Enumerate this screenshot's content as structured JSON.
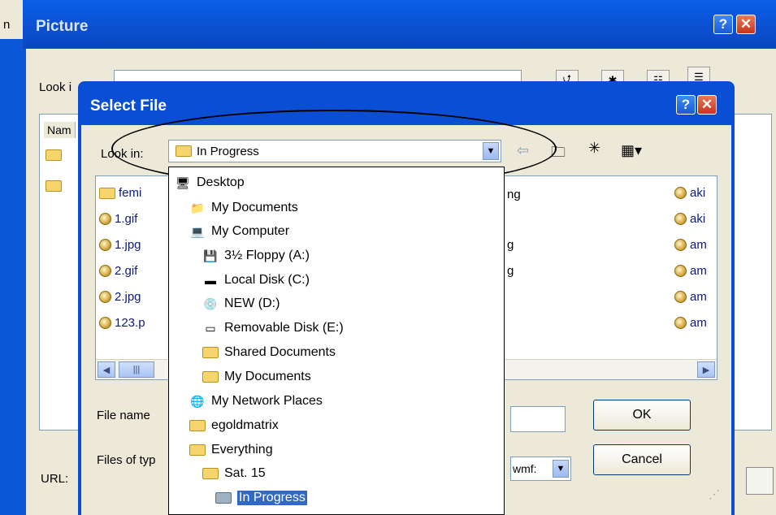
{
  "background_window": {
    "left_edge_char": "n",
    "title": "Picture",
    "look_in_label": "Look i",
    "name_header": "Nam",
    "url_label": "URL:"
  },
  "dialog": {
    "title": "Select File",
    "look_in_label": "Look in:",
    "look_in_value": "In Progress",
    "file_name_label": "File name",
    "files_of_type_label": "Files of typ",
    "files_of_type_value": "wmf:",
    "ok_label": "OK",
    "cancel_label": "Cancel"
  },
  "file_list": {
    "left_column": [
      "femi",
      "1.gif",
      "1.jpg",
      "2.gif",
      "2.jpg",
      "123.p"
    ],
    "middle_column": [
      "ng",
      "g",
      "g"
    ],
    "right_column": [
      "aki",
      "aki",
      "am",
      "am",
      "am",
      "am"
    ]
  },
  "dropdown": {
    "items": [
      {
        "label": "Desktop",
        "icon": "desktop-icon",
        "indent": 0,
        "selected": false
      },
      {
        "label": "My Documents",
        "icon": "my-documents-icon",
        "indent": 1,
        "selected": false
      },
      {
        "label": "My Computer",
        "icon": "my-computer-icon",
        "indent": 1,
        "selected": false
      },
      {
        "label": "3½ Floppy (A:)",
        "icon": "floppy-icon",
        "indent": 2,
        "selected": false
      },
      {
        "label": "Local Disk (C:)",
        "icon": "local-disk-icon",
        "indent": 2,
        "selected": false
      },
      {
        "label": "NEW (D:)",
        "icon": "cd-drive-icon",
        "indent": 2,
        "selected": false
      },
      {
        "label": "Removable Disk (E:)",
        "icon": "removable-disk-icon",
        "indent": 2,
        "selected": false
      },
      {
        "label": "Shared Documents",
        "icon": "folder-icon",
        "indent": 2,
        "selected": false
      },
      {
        "label": "My Documents",
        "icon": "folder-icon",
        "indent": 2,
        "selected": false
      },
      {
        "label": "My Network Places",
        "icon": "network-places-icon",
        "indent": 1,
        "selected": false
      },
      {
        "label": "egoldmatrix",
        "icon": "folder-icon",
        "indent": 1,
        "selected": false
      },
      {
        "label": "Everything",
        "icon": "folder-icon",
        "indent": 1,
        "selected": false
      },
      {
        "label": "Sat. 15",
        "icon": "folder-icon",
        "indent": 2,
        "selected": false
      },
      {
        "label": "In Progress",
        "icon": "open-folder-icon",
        "indent": 3,
        "selected": true
      }
    ]
  },
  "colors": {
    "xp_title_blue": "#0A4FD3",
    "window_face": "#ECE9D8",
    "selection_blue": "#316AC5",
    "link_text": "#0b1a7a"
  }
}
